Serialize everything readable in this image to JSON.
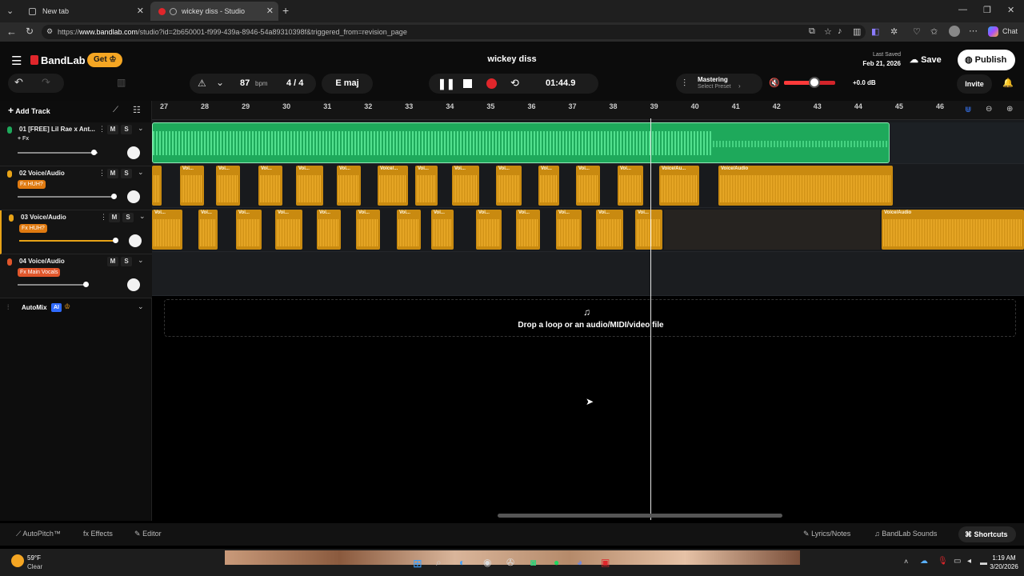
{
  "browser": {
    "tabs": [
      {
        "title": "New tab",
        "active": false
      },
      {
        "title": "wickey diss - Studio",
        "active": true
      }
    ],
    "url_prefix": "https://",
    "url_domain": "www.bandlab.com",
    "url_rest": "/studio?id=2b650001-f999-439a-8946-54a89310398f&triggered_from=revision_page",
    "copilot_label": "Chat"
  },
  "header": {
    "brand": "BandLab",
    "get_label": "Get",
    "project_title": "wickey diss",
    "last_saved_label": "Last Saved",
    "last_saved_date": "Feb 21, 2026",
    "save_label": "Save",
    "publish_label": "Publish",
    "invite_label": "Invite",
    "bpm_value": "87",
    "bpm_unit": "bpm",
    "time_sig": "4 / 4",
    "key": "E maj",
    "time_display": "01:44.9",
    "mastering_label": "Mastering",
    "mastering_sub": "Select Preset",
    "volume_db": "+0.0 dB",
    "volume_level": 0.6
  },
  "toolbar": {
    "add_track_label": "Add Track",
    "automix_label": "AutoMix",
    "ai_badge": "AI"
  },
  "ruler": {
    "ticks": [
      "27",
      "28",
      "29",
      "30",
      "31",
      "32",
      "33",
      "34",
      "35",
      "36",
      "37",
      "38",
      "39",
      "40",
      "41",
      "42",
      "43",
      "44",
      "45",
      "46"
    ]
  },
  "tracks": [
    {
      "name": "01 [FREE] Lil Rae x Ant...",
      "fx": "+ Fx",
      "color": "#1ea95b"
    },
    {
      "name": "02 Voice/Audio",
      "fx": "Fx HUH?",
      "color": "#e8a317"
    },
    {
      "name": "03 Voice/Audio",
      "fx": "Fx HUH?",
      "color": "#e8a317"
    },
    {
      "name": "04 Voice/Audio",
      "fx": "Fx Main Vocals",
      "color": "#e0562b"
    }
  ],
  "track_controls": {
    "mute": "M",
    "solo": "S"
  },
  "clip_labels": {
    "voice_short": "Voi...",
    "voice_mid": "Voice/...",
    "voice_long": "Voice/Au...",
    "voice_full": "Voice/Audio"
  },
  "dropzone": {
    "text": "Drop a loop or an audio/MIDI/video file"
  },
  "bottom": {
    "autopitch": "AutoPitch™",
    "effects": "Effects",
    "editor": "Editor",
    "lyrics": "Lyrics/Notes",
    "sounds": "BandLab Sounds",
    "shortcuts": "Shortcuts"
  },
  "taskbar": {
    "temp": "59°F",
    "weather": "Clear",
    "time": "1:19 AM",
    "date": "3/20/2026"
  },
  "colors": {
    "accent_orange": "#f5a623",
    "beat_green": "#1ea95b",
    "record_red": "#e0262b",
    "volume_red": "#d3242a"
  }
}
